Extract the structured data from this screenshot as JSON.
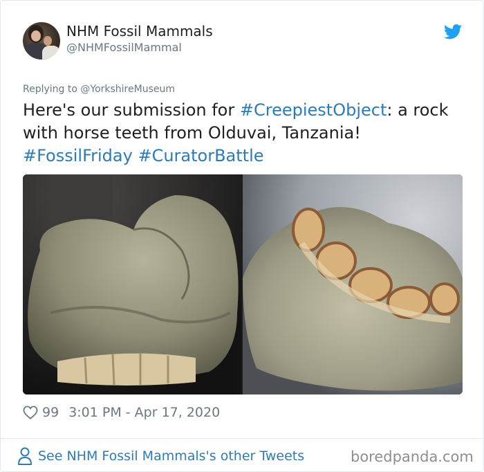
{
  "author": {
    "name": "NHM Fossil Mammals",
    "handle": "@NHMFossilMammal"
  },
  "reply_context": "Replying to @YorkshireMuseum",
  "tweet": {
    "line1_a": "Here's our submission for ",
    "line1_tag": "#CreepiestObject",
    "line1_b": ": a rock",
    "line2": "with horse teeth from Olduvai, Tanzania!",
    "tag_fossil_friday": "#FossilFriday",
    "tag_curator_battle": "#CuratorBattle"
  },
  "meta": {
    "like_count": "99",
    "timestamp": "3:01 PM - Apr 17, 2020"
  },
  "footer": {
    "other_tweets_link": "See NHM Fossil Mammals's other Tweets",
    "watermark": "boredpanda.com"
  },
  "icons": {
    "twitter": "twitter-bird-icon",
    "like": "heart-icon",
    "profile": "person-icon"
  },
  "colors": {
    "link": "#2b7bb9",
    "twitter_blue": "#1da1f2",
    "muted": "#697882"
  }
}
